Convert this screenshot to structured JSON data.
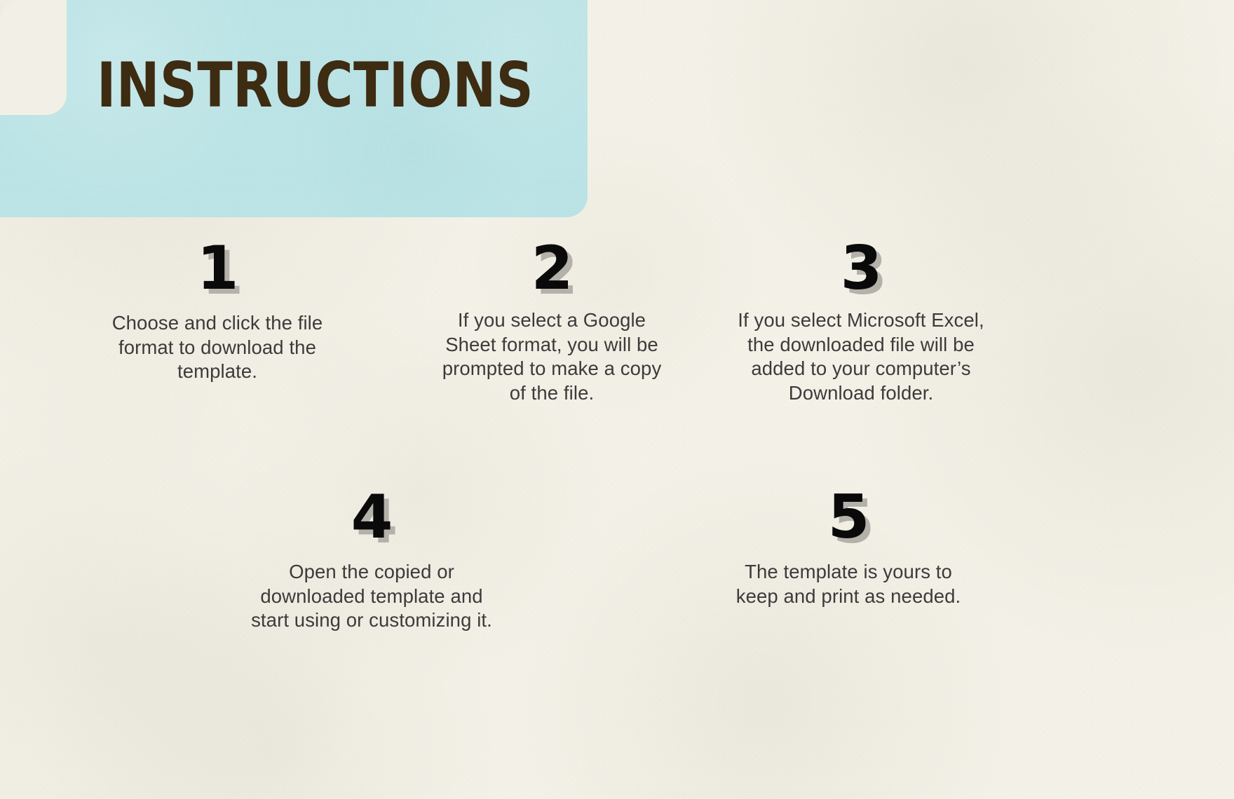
{
  "page": {
    "background_color": "#f5f3e9",
    "accent_color": "#bce4e6",
    "title_color": "#3d2b12",
    "body_text_color": "#3b3b3b",
    "number_color": "#0a0a0a",
    "number_shadow_color": "#b4b1ab"
  },
  "header": {
    "title": "INSTRUCTIONS"
  },
  "steps": [
    {
      "number": "1",
      "text": "Choose and click the file\nformat to download the\ntemplate."
    },
    {
      "number": "2",
      "text": "If you select a Google\nSheet format, you will be\nprompted to make a copy\nof the file."
    },
    {
      "number": "3",
      "text": "If you select Microsoft Excel,\nthe downloaded file will be\nadded to your computer’s\nDownload  folder."
    },
    {
      "number": "4",
      "text": "Open the copied or\ndownloaded template and\nstart using or customizing it."
    },
    {
      "number": "5",
      "text": "The template is yours to\nkeep and print as needed."
    }
  ]
}
